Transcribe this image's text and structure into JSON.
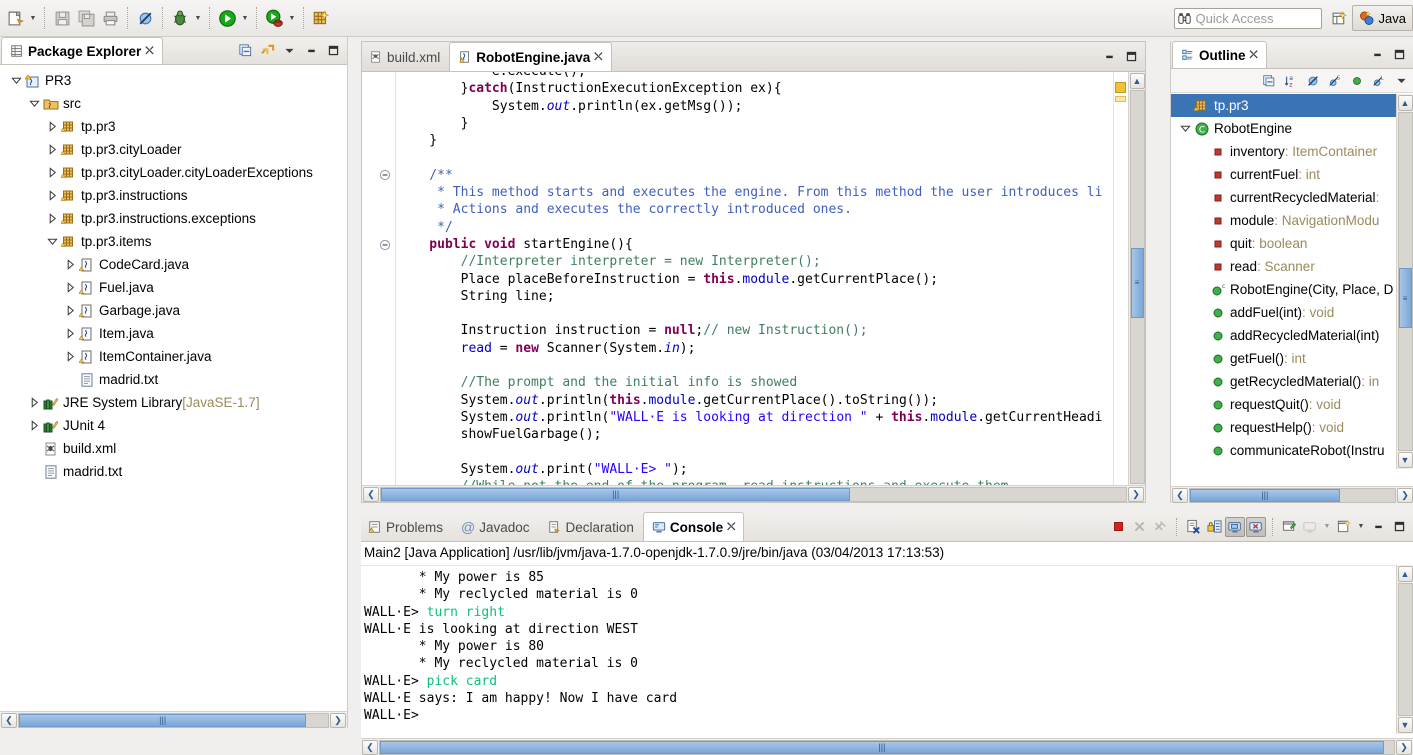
{
  "toolbar": {
    "buttons": [
      {
        "name": "new-wizard",
        "icon": "new-file-icon",
        "has_arrow": true
      },
      {
        "name": "save",
        "icon": "save-icon",
        "has_arrow": false
      },
      {
        "name": "save-all",
        "icon": "save-all-icon",
        "has_arrow": false
      },
      {
        "name": "print",
        "icon": "print-icon",
        "has_arrow": false
      },
      {
        "name": "skip-breakpoints",
        "icon": "skip-breakpoints-icon",
        "has_arrow": false
      },
      {
        "name": "debug",
        "icon": "debug-bug-icon",
        "has_arrow": true
      },
      {
        "name": "run",
        "icon": "run-play-icon",
        "has_arrow": true
      },
      {
        "name": "external-tools",
        "icon": "external-tools-icon",
        "has_arrow": true
      },
      {
        "name": "new-java-project",
        "icon": "new-java-project-icon",
        "has_arrow": false
      }
    ],
    "quick_access_placeholder": "Quick Access",
    "quick_access_value": "",
    "open-perspective": "open-perspective-icon",
    "perspective_label": "Java"
  },
  "package_explorer": {
    "title": "Package Explorer",
    "tools": [
      "collapse-all-icon",
      "link-with-editor-icon",
      "view-menu-icon",
      "minimize-icon",
      "maximize-icon"
    ],
    "tree": [
      {
        "depth": 0,
        "twist": "open",
        "icon": "java-project-icon",
        "label": "PR3",
        "dim": ""
      },
      {
        "depth": 1,
        "twist": "open",
        "icon": "source-folder-icon",
        "label": "src",
        "dim": ""
      },
      {
        "depth": 2,
        "twist": "closed",
        "icon": "package-icon",
        "label": "tp.pr3",
        "dim": ""
      },
      {
        "depth": 2,
        "twist": "closed",
        "icon": "package-icon",
        "label": "tp.pr3.cityLoader",
        "dim": ""
      },
      {
        "depth": 2,
        "twist": "closed",
        "icon": "package-icon",
        "label": "tp.pr3.cityLoader.cityLoaderExceptions",
        "dim": ""
      },
      {
        "depth": 2,
        "twist": "closed",
        "icon": "package-icon",
        "label": "tp.pr3.instructions",
        "dim": ""
      },
      {
        "depth": 2,
        "twist": "closed",
        "icon": "package-icon",
        "label": "tp.pr3.instructions.exceptions",
        "dim": ""
      },
      {
        "depth": 2,
        "twist": "open",
        "icon": "package-icon",
        "label": "tp.pr3.items",
        "dim": ""
      },
      {
        "depth": 3,
        "twist": "closed",
        "icon": "java-file-icon",
        "label": "CodeCard.java",
        "dim": ""
      },
      {
        "depth": 3,
        "twist": "closed",
        "icon": "java-file-icon",
        "label": "Fuel.java",
        "dim": ""
      },
      {
        "depth": 3,
        "twist": "closed",
        "icon": "java-file-icon",
        "label": "Garbage.java",
        "dim": ""
      },
      {
        "depth": 3,
        "twist": "closed",
        "icon": "java-file-icon",
        "label": "Item.java",
        "dim": ""
      },
      {
        "depth": 3,
        "twist": "closed",
        "icon": "java-file-icon",
        "label": "ItemContainer.java",
        "dim": ""
      },
      {
        "depth": 3,
        "twist": "none",
        "icon": "text-file-icon",
        "label": "madrid.txt",
        "dim": ""
      },
      {
        "depth": 1,
        "twist": "closed",
        "icon": "library-icon",
        "label": "JRE System Library ",
        "dim": "[JavaSE-1.7]"
      },
      {
        "depth": 1,
        "twist": "closed",
        "icon": "library-icon",
        "label": "JUnit 4",
        "dim": ""
      },
      {
        "depth": 1,
        "twist": "none",
        "icon": "ant-file-icon",
        "label": "build.xml",
        "dim": ""
      },
      {
        "depth": 1,
        "twist": "none",
        "icon": "text-file-icon",
        "label": "madrid.txt",
        "dim": ""
      }
    ],
    "hscroll_thumb_pct": 93
  },
  "editor": {
    "tabs": [
      {
        "label": "build.xml",
        "icon": "ant-file-icon",
        "active": false,
        "closable": false
      },
      {
        "label": "RobotEngine.java",
        "icon": "java-file-warning-icon",
        "active": true,
        "closable": true
      }
    ],
    "tools": [
      "minimize-icon",
      "maximize-icon"
    ],
    "lines": [
      {
        "fold": "",
        "segs": [
          {
            "t": "            e.execute();",
            "c": "plain"
          }
        ]
      },
      {
        "fold": "",
        "segs": [
          {
            "t": "        }",
            "c": "plain"
          },
          {
            "t": "catch",
            "c": "kw"
          },
          {
            "t": "(InstructionExecutionException ex){",
            "c": "plain"
          }
        ]
      },
      {
        "fold": "",
        "segs": [
          {
            "t": "            System.",
            "c": "plain"
          },
          {
            "t": "out",
            "c": "fld"
          },
          {
            "t": ".println(ex.getMsg());",
            "c": "plain"
          }
        ]
      },
      {
        "fold": "",
        "segs": [
          {
            "t": "        }",
            "c": "plain"
          }
        ]
      },
      {
        "fold": "",
        "segs": [
          {
            "t": "    }",
            "c": "plain"
          }
        ]
      },
      {
        "fold": "",
        "segs": [
          {
            "t": "",
            "c": "plain"
          }
        ]
      },
      {
        "fold": "minus",
        "segs": [
          {
            "t": "    /**",
            "c": "jdoc"
          }
        ]
      },
      {
        "fold": "",
        "segs": [
          {
            "t": "     * This method starts and executes the engine. From this method the user introduces li",
            "c": "jdoc"
          }
        ]
      },
      {
        "fold": "",
        "segs": [
          {
            "t": "     * Actions and executes the correctly introduced ones.",
            "c": "jdoc"
          }
        ]
      },
      {
        "fold": "",
        "segs": [
          {
            "t": "     */",
            "c": "jdoc"
          }
        ]
      },
      {
        "fold": "minus",
        "segs": [
          {
            "t": "    public void ",
            "c": "kw"
          },
          {
            "t": "startEngine(){",
            "c": "plain"
          }
        ]
      },
      {
        "fold": "",
        "segs": [
          {
            "t": "        //Interpreter interpreter = new Interpreter();",
            "c": "cmt"
          }
        ]
      },
      {
        "fold": "",
        "segs": [
          {
            "t": "        Place placeBeforeInstruction = ",
            "c": "plain"
          },
          {
            "t": "this",
            "c": "kw"
          },
          {
            "t": ".",
            "c": "plain"
          },
          {
            "t": "module",
            "c": "lfld"
          },
          {
            "t": ".getCurrentPlace();",
            "c": "plain"
          }
        ]
      },
      {
        "fold": "",
        "segs": [
          {
            "t": "        String line;",
            "c": "plain"
          }
        ]
      },
      {
        "fold": "",
        "segs": [
          {
            "t": "",
            "c": "plain"
          }
        ]
      },
      {
        "fold": "",
        "segs": [
          {
            "t": "        Instruction instruction = ",
            "c": "plain"
          },
          {
            "t": "null",
            "c": "kw"
          },
          {
            "t": ";",
            "c": "plain"
          },
          {
            "t": "// new Instruction();",
            "c": "cmt"
          }
        ]
      },
      {
        "fold": "",
        "segs": [
          {
            "t": "        ",
            "c": "plain"
          },
          {
            "t": "read",
            "c": "lfld"
          },
          {
            "t": " = ",
            "c": "plain"
          },
          {
            "t": "new",
            "c": "kw"
          },
          {
            "t": " Scanner(System.",
            "c": "plain"
          },
          {
            "t": "in",
            "c": "fld"
          },
          {
            "t": ");",
            "c": "plain"
          }
        ]
      },
      {
        "fold": "",
        "segs": [
          {
            "t": "",
            "c": "plain"
          }
        ]
      },
      {
        "fold": "",
        "segs": [
          {
            "t": "        //The prompt and the initial info is showed",
            "c": "cmt"
          }
        ]
      },
      {
        "fold": "",
        "segs": [
          {
            "t": "        System.",
            "c": "plain"
          },
          {
            "t": "out",
            "c": "fld"
          },
          {
            "t": ".println(",
            "c": "plain"
          },
          {
            "t": "this",
            "c": "kw"
          },
          {
            "t": ".",
            "c": "plain"
          },
          {
            "t": "module",
            "c": "lfld"
          },
          {
            "t": ".getCurrentPlace().toString());",
            "c": "plain"
          }
        ]
      },
      {
        "fold": "",
        "segs": [
          {
            "t": "        System.",
            "c": "plain"
          },
          {
            "t": "out",
            "c": "fld"
          },
          {
            "t": ".println(",
            "c": "plain"
          },
          {
            "t": "\"WALL·E is looking at direction \"",
            "c": "str"
          },
          {
            "t": " + ",
            "c": "plain"
          },
          {
            "t": "this",
            "c": "kw"
          },
          {
            "t": ".",
            "c": "plain"
          },
          {
            "t": "module",
            "c": "lfld"
          },
          {
            "t": ".getCurrentHeadi",
            "c": "plain"
          }
        ]
      },
      {
        "fold": "",
        "segs": [
          {
            "t": "        showFuelGarbage();",
            "c": "plain"
          }
        ]
      },
      {
        "fold": "",
        "segs": [
          {
            "t": "",
            "c": "plain"
          }
        ]
      },
      {
        "fold": "",
        "segs": [
          {
            "t": "        System.",
            "c": "plain"
          },
          {
            "t": "out",
            "c": "fld"
          },
          {
            "t": ".print(",
            "c": "plain"
          },
          {
            "t": "\"WALL·E> \"",
            "c": "str"
          },
          {
            "t": ");",
            "c": "plain"
          }
        ]
      },
      {
        "fold": "",
        "segs": [
          {
            "t": "        //While not the end of the program, read instructions and execute them",
            "c": "cmt"
          }
        ]
      }
    ],
    "hscroll_thumb_pct": 63,
    "vscroll_thumb_top_pct": 52
  },
  "outline": {
    "title": "Outline",
    "tools": [
      "minimize-icon",
      "maximize-icon"
    ],
    "toolbar_icons": [
      "collapse-all-icon",
      "sort-az-icon",
      "hide-fields-icon",
      "hide-static-icon",
      "hide-nonpublic-icon",
      "hide-local-icon",
      "view-menu-icon"
    ],
    "items": [
      {
        "depth": 0,
        "twist": "none",
        "icon": "package-icon",
        "label": "tp.pr3",
        "type": "",
        "selected": true
      },
      {
        "depth": 0,
        "twist": "open",
        "icon": "class-icon",
        "label": "RobotEngine",
        "type": "",
        "selected": false
      },
      {
        "depth": 1,
        "twist": "none",
        "icon": "field-private-icon",
        "label": "inventory",
        "type": " : ItemContainer",
        "selected": false
      },
      {
        "depth": 1,
        "twist": "none",
        "icon": "field-private-icon",
        "label": "currentFuel",
        "type": " : int",
        "selected": false
      },
      {
        "depth": 1,
        "twist": "none",
        "icon": "field-private-icon",
        "label": "currentRecycledMaterial",
        "type": " :",
        "selected": false
      },
      {
        "depth": 1,
        "twist": "none",
        "icon": "field-private-icon",
        "label": "module",
        "type": " : NavigationModu",
        "selected": false
      },
      {
        "depth": 1,
        "twist": "none",
        "icon": "field-private-icon",
        "label": "quit",
        "type": " : boolean",
        "selected": false
      },
      {
        "depth": 1,
        "twist": "none",
        "icon": "field-private-icon",
        "label": "read",
        "type": " : Scanner",
        "selected": false
      },
      {
        "depth": 1,
        "twist": "none",
        "icon": "constructor-icon",
        "label": "RobotEngine(City, Place, D",
        "type": "",
        "selected": false
      },
      {
        "depth": 1,
        "twist": "none",
        "icon": "method-public-icon",
        "label": "addFuel(int)",
        "type": " : void",
        "selected": false
      },
      {
        "depth": 1,
        "twist": "none",
        "icon": "method-public-icon",
        "label": "addRecycledMaterial(int)",
        "type": "",
        "selected": false
      },
      {
        "depth": 1,
        "twist": "none",
        "icon": "method-public-icon",
        "label": "getFuel()",
        "type": " : int",
        "selected": false
      },
      {
        "depth": 1,
        "twist": "none",
        "icon": "method-public-icon",
        "label": "getRecycledMaterial()",
        "type": " : in",
        "selected": false
      },
      {
        "depth": 1,
        "twist": "none",
        "icon": "method-public-icon",
        "label": "requestQuit()",
        "type": " : void",
        "selected": false
      },
      {
        "depth": 1,
        "twist": "none",
        "icon": "method-public-icon",
        "label": "requestHelp()",
        "type": " : void",
        "selected": false
      },
      {
        "depth": 1,
        "twist": "none",
        "icon": "method-public-icon",
        "label": "communicateRobot(Instru",
        "type": "",
        "selected": false
      }
    ],
    "hscroll_thumb_pct": 73
  },
  "console": {
    "tabs": [
      {
        "label": "Problems",
        "icon": "problems-icon",
        "active": false
      },
      {
        "label": "Javadoc",
        "icon": "javadoc-icon",
        "active": false
      },
      {
        "label": "Declaration",
        "icon": "declaration-icon",
        "active": false
      },
      {
        "label": "Console",
        "icon": "console-icon",
        "active": true,
        "closable": true
      }
    ],
    "tools": [
      {
        "name": "terminate-button",
        "icon": "terminate-red-square-icon",
        "enabled": true,
        "toggled": false
      },
      {
        "name": "remove-launch-button",
        "icon": "remove-x-icon",
        "enabled": false,
        "toggled": false
      },
      {
        "name": "remove-all-terminated-button",
        "icon": "remove-all-x-icon",
        "enabled": false,
        "toggled": false
      },
      {
        "name": "clear-console-button",
        "icon": "clear-console-icon",
        "enabled": true,
        "toggled": false
      },
      {
        "name": "scroll-lock-button",
        "icon": "scroll-lock-icon",
        "enabled": true,
        "toggled": false
      },
      {
        "name": "show-console-on-output-button",
        "icon": "show-console-output-icon",
        "enabled": true,
        "toggled": true
      },
      {
        "name": "show-console-on-error-button",
        "icon": "show-console-error-icon",
        "enabled": true,
        "toggled": true
      },
      {
        "name": "pin-console-button",
        "icon": "pin-console-icon",
        "enabled": true,
        "toggled": false
      },
      {
        "name": "display-selected-console-button",
        "icon": "display-console-icon",
        "enabled": false,
        "toggled": false,
        "has_arrow": true
      },
      {
        "name": "open-console-button",
        "icon": "open-console-icon",
        "enabled": true,
        "toggled": false,
        "has_arrow": true
      },
      {
        "name": "minimize-button",
        "icon": "minimize-icon",
        "enabled": true,
        "toggled": false
      },
      {
        "name": "maximize-button",
        "icon": "maximize-icon",
        "enabled": true,
        "toggled": false
      }
    ],
    "header": "Main2 [Java Application] /usr/lib/jvm/java-1.7.0-openjdk-1.7.0.9/jre/bin/java (03/04/2013 17:13:53)",
    "lines": [
      [
        {
          "t": "       * My power is 85",
          "c": "out"
        }
      ],
      [
        {
          "t": "       * My reclycled material is 0",
          "c": "out"
        }
      ],
      [
        {
          "t": "WALL·E> ",
          "c": "out"
        },
        {
          "t": "turn right",
          "c": "in"
        }
      ],
      [
        {
          "t": "WALL·E is looking at direction WEST",
          "c": "out"
        }
      ],
      [
        {
          "t": "       * My power is 80",
          "c": "out"
        }
      ],
      [
        {
          "t": "       * My reclycled material is 0",
          "c": "out"
        }
      ],
      [
        {
          "t": "WALL·E> ",
          "c": "out"
        },
        {
          "t": "pick card",
          "c": "in"
        }
      ],
      [
        {
          "t": "WALL·E says: I am happy! Now I have card",
          "c": "out"
        }
      ],
      [
        {
          "t": "WALL·E>",
          "c": "out"
        }
      ]
    ],
    "hscroll_thumb_pct": 99
  },
  "colors": {
    "selection_blue": "#3a74b5",
    "accent_scroll": "#79a6d8",
    "panel_bg": "#f0efee",
    "console_input": "#00b04f",
    "keyword": "#7f0055",
    "string": "#2a00ff",
    "comment": "#3f7f5f",
    "javadoc": "#3f5fbf",
    "field": "#0000c0",
    "type_dim": "#9a8a5c"
  }
}
